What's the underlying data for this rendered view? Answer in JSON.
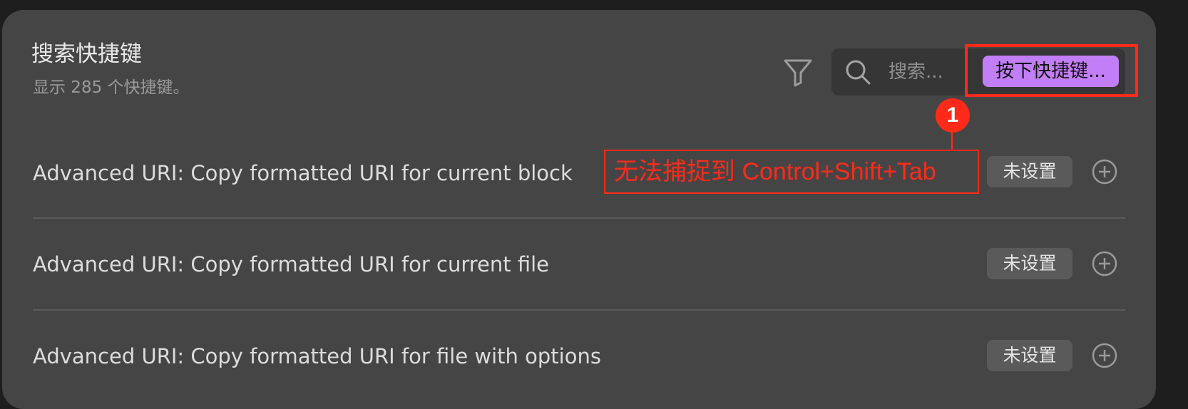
{
  "header": {
    "title": "搜索快捷键",
    "subtitle": "显示 285 个快捷键。"
  },
  "toolbar": {
    "filter_icon": "filter-icon",
    "search_icon": "search-icon",
    "search_placeholder": "搜索...",
    "capture_button_label": "按下快捷键..."
  },
  "annotation": {
    "step_number": "1",
    "note": "无法捕捉到 Control+Shift+Tab",
    "color": "#ff2a1a"
  },
  "hotkeys": [
    {
      "label": "Advanced URI: Copy formatted URI for current block",
      "status": "未设置"
    },
    {
      "label": "Advanced URI: Copy formatted URI for current file",
      "status": "未设置"
    },
    {
      "label": "Advanced URI: Copy formatted URI for file with options",
      "status": "未设置"
    }
  ],
  "colors": {
    "panel_bg": "#454545",
    "capture_button_bg": "#c27ef6",
    "highlight": "#ff2a1a"
  }
}
